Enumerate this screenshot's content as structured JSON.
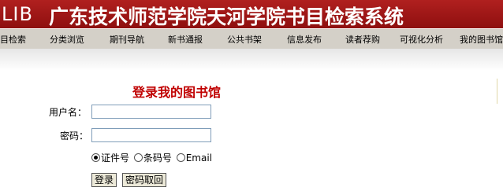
{
  "header": {
    "logo": "LIB",
    "title": "广东技术师范学院天河学院书目检索系统"
  },
  "nav": {
    "items": [
      "目检索",
      "分类浏览",
      "期刊导航",
      "新书通报",
      "公共书架",
      "信息发布",
      "读者荐购",
      "可视化分析",
      "我的图书馆"
    ]
  },
  "login": {
    "title": "登录我的图书馆",
    "username_label": "用户名：",
    "username_value": "",
    "password_label": "密码：",
    "password_value": "",
    "radio_options": [
      "证件号",
      "条码号",
      "Email"
    ],
    "radio_selected": "证件号",
    "login_button": "登录",
    "reset_button": "密码取回"
  }
}
